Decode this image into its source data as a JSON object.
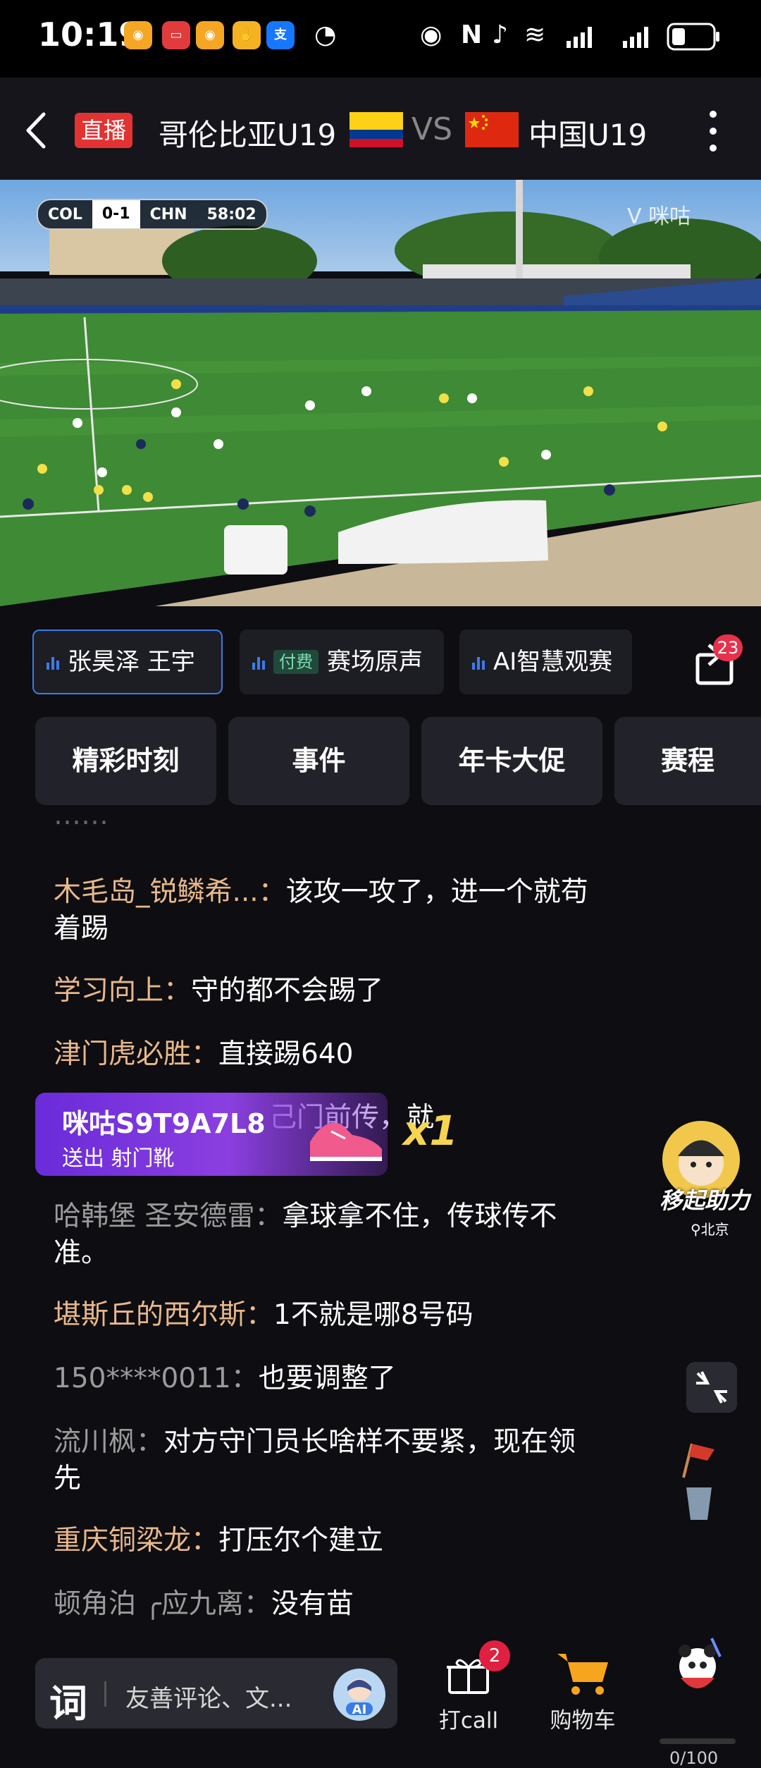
{
  "status_bar": {
    "time": "10:19",
    "app_icons": [
      {
        "name": "weibo-icon",
        "color": "#f5a623"
      },
      {
        "name": "tv-app-icon",
        "color": "#e23b3b"
      },
      {
        "name": "weibo-2-icon",
        "color": "#f5a623"
      },
      {
        "name": "handshake-app-icon",
        "color": "#f5b323"
      },
      {
        "name": "alipay-icon",
        "color": "#1677ff",
        "text": "支"
      }
    ]
  },
  "top_bar": {
    "live_badge": "直播",
    "team_home": "哥伦比亚U19",
    "vs": "VS",
    "team_away": "中国U19"
  },
  "video": {
    "scoreboard": {
      "home": "COL",
      "score": "0-1",
      "away": "CHN",
      "time": "58:02"
    },
    "watermark": "咪咕"
  },
  "commentary_tabs": [
    {
      "label": "张昊泽 王宇",
      "active": true
    },
    {
      "label": "赛场原声",
      "badge": "付费",
      "active": false
    },
    {
      "label": "AI智慧观赛",
      "active": false
    }
  ],
  "share_badge": "23",
  "section_tabs": [
    "精彩时刻",
    "事件",
    "年卡大促",
    "赛程"
  ],
  "comments": [
    {
      "user": "木毛岛_锐鳞希...",
      "text": "该攻一攻了，进一个就苟着踢",
      "user_color": "gold"
    },
    {
      "user": "学习向上",
      "text": "守的都不会踢了",
      "user_color": "gold"
    },
    {
      "user": "津门虎必胜",
      "text": "直接踢640",
      "user_color": "gold"
    },
    {
      "user": "",
      "text": "己门前传，就",
      "user_color": "gray"
    },
    {
      "user": "哈韩堡 圣安德雷",
      "text": "拿球拿不住，传球传不准。",
      "user_color": "gray"
    },
    {
      "user": "堪斯丘的西尔斯",
      "text": "1不就是哪8号码",
      "user_color": "gold"
    },
    {
      "user": "150****0011",
      "text": "也要调整了",
      "user_color": "gray"
    },
    {
      "user": "流川枫",
      "text": "对方守门员长啥样不要紧，现在领先",
      "user_color": "gray"
    },
    {
      "user": "重庆铜梁龙",
      "text": "打压尔个建立",
      "user_color": "gold"
    },
    {
      "user": "顿角泊 ╭应九离",
      "text": "没有苗",
      "user_color": "gray"
    }
  ],
  "gift": {
    "sender": "咪咕S9T9A7L8",
    "label": "送出 射门靴",
    "count": "x1"
  },
  "side_widget": {
    "label": "移起助力",
    "location": "北京"
  },
  "bottom_bar": {
    "input_placeholder": "友善评论、文...",
    "ai_label": "AI",
    "call_label": "打call",
    "call_badge": "2",
    "cart_label": "购物车",
    "progress": "0/100"
  },
  "colors": {
    "accent_blue": "#3b7be8",
    "live_red": "#e23232",
    "username_gold": "#e8b88a",
    "gift_purple": "#7a35dd",
    "badge_red": "#e9314c"
  }
}
